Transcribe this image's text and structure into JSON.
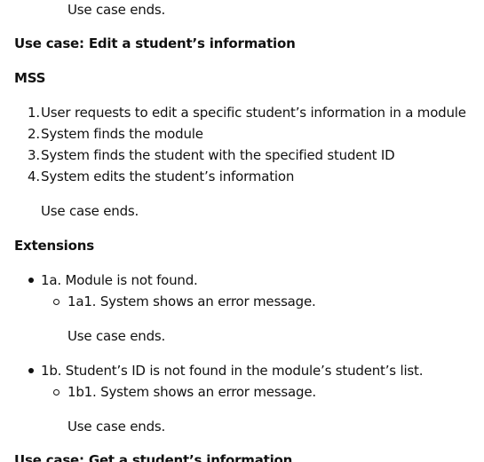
{
  "top_ends": "Use case ends.",
  "use_case": {
    "heading": "Use case: Edit a student’s information",
    "mss_heading": "MSS",
    "steps": [
      {
        "num": "1.",
        "text": "User requests to edit a specific student’s information in a module"
      },
      {
        "num": "2.",
        "text": "System finds the module"
      },
      {
        "num": "3.",
        "text": "System finds the student with the specified student ID"
      },
      {
        "num": "4.",
        "text": "System edits the student’s information"
      }
    ],
    "mss_ends": "Use case ends.",
    "extensions_heading": "Extensions",
    "extensions": [
      {
        "text": "1a. Module is not found.",
        "sub": "1a1. System shows an error message.",
        "ends": "Use case ends."
      },
      {
        "text": "1b. Student’s ID is not found in the module’s student’s list.",
        "sub": "1b1. System shows an error message.",
        "ends": "Use case ends."
      }
    ]
  },
  "next_heading": "Use case: Get a student’s information"
}
